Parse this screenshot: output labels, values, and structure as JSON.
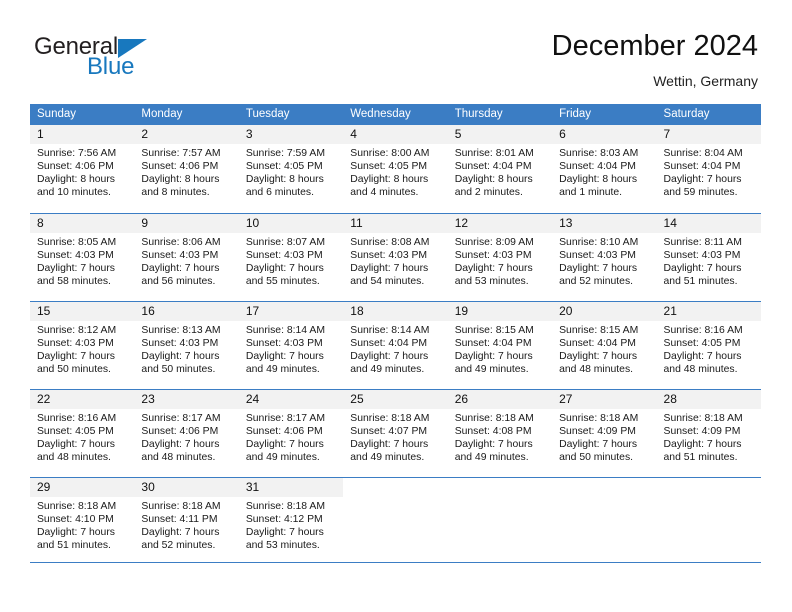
{
  "brand": {
    "name_top": "General",
    "name_bottom": "Blue",
    "accent_color": "#1878be"
  },
  "header": {
    "title": "December 2024",
    "location": "Wettin, Germany"
  },
  "theme": {
    "header_blue": "#3b7dc4",
    "day_band_gray": "#f2f2f2"
  },
  "weekdays": [
    "Sunday",
    "Monday",
    "Tuesday",
    "Wednesday",
    "Thursday",
    "Friday",
    "Saturday"
  ],
  "weeks": [
    [
      {
        "day": "1",
        "sunrise": "Sunrise: 7:56 AM",
        "sunset": "Sunset: 4:06 PM",
        "daylight_1": "Daylight: 8 hours",
        "daylight_2": "and 10 minutes."
      },
      {
        "day": "2",
        "sunrise": "Sunrise: 7:57 AM",
        "sunset": "Sunset: 4:06 PM",
        "daylight_1": "Daylight: 8 hours",
        "daylight_2": "and 8 minutes."
      },
      {
        "day": "3",
        "sunrise": "Sunrise: 7:59 AM",
        "sunset": "Sunset: 4:05 PM",
        "daylight_1": "Daylight: 8 hours",
        "daylight_2": "and 6 minutes."
      },
      {
        "day": "4",
        "sunrise": "Sunrise: 8:00 AM",
        "sunset": "Sunset: 4:05 PM",
        "daylight_1": "Daylight: 8 hours",
        "daylight_2": "and 4 minutes."
      },
      {
        "day": "5",
        "sunrise": "Sunrise: 8:01 AM",
        "sunset": "Sunset: 4:04 PM",
        "daylight_1": "Daylight: 8 hours",
        "daylight_2": "and 2 minutes."
      },
      {
        "day": "6",
        "sunrise": "Sunrise: 8:03 AM",
        "sunset": "Sunset: 4:04 PM",
        "daylight_1": "Daylight: 8 hours",
        "daylight_2": "and 1 minute."
      },
      {
        "day": "7",
        "sunrise": "Sunrise: 8:04 AM",
        "sunset": "Sunset: 4:04 PM",
        "daylight_1": "Daylight: 7 hours",
        "daylight_2": "and 59 minutes."
      }
    ],
    [
      {
        "day": "8",
        "sunrise": "Sunrise: 8:05 AM",
        "sunset": "Sunset: 4:03 PM",
        "daylight_1": "Daylight: 7 hours",
        "daylight_2": "and 58 minutes."
      },
      {
        "day": "9",
        "sunrise": "Sunrise: 8:06 AM",
        "sunset": "Sunset: 4:03 PM",
        "daylight_1": "Daylight: 7 hours",
        "daylight_2": "and 56 minutes."
      },
      {
        "day": "10",
        "sunrise": "Sunrise: 8:07 AM",
        "sunset": "Sunset: 4:03 PM",
        "daylight_1": "Daylight: 7 hours",
        "daylight_2": "and 55 minutes."
      },
      {
        "day": "11",
        "sunrise": "Sunrise: 8:08 AM",
        "sunset": "Sunset: 4:03 PM",
        "daylight_1": "Daylight: 7 hours",
        "daylight_2": "and 54 minutes."
      },
      {
        "day": "12",
        "sunrise": "Sunrise: 8:09 AM",
        "sunset": "Sunset: 4:03 PM",
        "daylight_1": "Daylight: 7 hours",
        "daylight_2": "and 53 minutes."
      },
      {
        "day": "13",
        "sunrise": "Sunrise: 8:10 AM",
        "sunset": "Sunset: 4:03 PM",
        "daylight_1": "Daylight: 7 hours",
        "daylight_2": "and 52 minutes."
      },
      {
        "day": "14",
        "sunrise": "Sunrise: 8:11 AM",
        "sunset": "Sunset: 4:03 PM",
        "daylight_1": "Daylight: 7 hours",
        "daylight_2": "and 51 minutes."
      }
    ],
    [
      {
        "day": "15",
        "sunrise": "Sunrise: 8:12 AM",
        "sunset": "Sunset: 4:03 PM",
        "daylight_1": "Daylight: 7 hours",
        "daylight_2": "and 50 minutes."
      },
      {
        "day": "16",
        "sunrise": "Sunrise: 8:13 AM",
        "sunset": "Sunset: 4:03 PM",
        "daylight_1": "Daylight: 7 hours",
        "daylight_2": "and 50 minutes."
      },
      {
        "day": "17",
        "sunrise": "Sunrise: 8:14 AM",
        "sunset": "Sunset: 4:03 PM",
        "daylight_1": "Daylight: 7 hours",
        "daylight_2": "and 49 minutes."
      },
      {
        "day": "18",
        "sunrise": "Sunrise: 8:14 AM",
        "sunset": "Sunset: 4:04 PM",
        "daylight_1": "Daylight: 7 hours",
        "daylight_2": "and 49 minutes."
      },
      {
        "day": "19",
        "sunrise": "Sunrise: 8:15 AM",
        "sunset": "Sunset: 4:04 PM",
        "daylight_1": "Daylight: 7 hours",
        "daylight_2": "and 49 minutes."
      },
      {
        "day": "20",
        "sunrise": "Sunrise: 8:15 AM",
        "sunset": "Sunset: 4:04 PM",
        "daylight_1": "Daylight: 7 hours",
        "daylight_2": "and 48 minutes."
      },
      {
        "day": "21",
        "sunrise": "Sunrise: 8:16 AM",
        "sunset": "Sunset: 4:05 PM",
        "daylight_1": "Daylight: 7 hours",
        "daylight_2": "and 48 minutes."
      }
    ],
    [
      {
        "day": "22",
        "sunrise": "Sunrise: 8:16 AM",
        "sunset": "Sunset: 4:05 PM",
        "daylight_1": "Daylight: 7 hours",
        "daylight_2": "and 48 minutes."
      },
      {
        "day": "23",
        "sunrise": "Sunrise: 8:17 AM",
        "sunset": "Sunset: 4:06 PM",
        "daylight_1": "Daylight: 7 hours",
        "daylight_2": "and 48 minutes."
      },
      {
        "day": "24",
        "sunrise": "Sunrise: 8:17 AM",
        "sunset": "Sunset: 4:06 PM",
        "daylight_1": "Daylight: 7 hours",
        "daylight_2": "and 49 minutes."
      },
      {
        "day": "25",
        "sunrise": "Sunrise: 8:18 AM",
        "sunset": "Sunset: 4:07 PM",
        "daylight_1": "Daylight: 7 hours",
        "daylight_2": "and 49 minutes."
      },
      {
        "day": "26",
        "sunrise": "Sunrise: 8:18 AM",
        "sunset": "Sunset: 4:08 PM",
        "daylight_1": "Daylight: 7 hours",
        "daylight_2": "and 49 minutes."
      },
      {
        "day": "27",
        "sunrise": "Sunrise: 8:18 AM",
        "sunset": "Sunset: 4:09 PM",
        "daylight_1": "Daylight: 7 hours",
        "daylight_2": "and 50 minutes."
      },
      {
        "day": "28",
        "sunrise": "Sunrise: 8:18 AM",
        "sunset": "Sunset: 4:09 PM",
        "daylight_1": "Daylight: 7 hours",
        "daylight_2": "and 51 minutes."
      }
    ],
    [
      {
        "day": "29",
        "sunrise": "Sunrise: 8:18 AM",
        "sunset": "Sunset: 4:10 PM",
        "daylight_1": "Daylight: 7 hours",
        "daylight_2": "and 51 minutes."
      },
      {
        "day": "30",
        "sunrise": "Sunrise: 8:18 AM",
        "sunset": "Sunset: 4:11 PM",
        "daylight_1": "Daylight: 7 hours",
        "daylight_2": "and 52 minutes."
      },
      {
        "day": "31",
        "sunrise": "Sunrise: 8:18 AM",
        "sunset": "Sunset: 4:12 PM",
        "daylight_1": "Daylight: 7 hours",
        "daylight_2": "and 53 minutes."
      },
      {
        "day": "",
        "sunrise": "",
        "sunset": "",
        "daylight_1": "",
        "daylight_2": ""
      },
      {
        "day": "",
        "sunrise": "",
        "sunset": "",
        "daylight_1": "",
        "daylight_2": ""
      },
      {
        "day": "",
        "sunrise": "",
        "sunset": "",
        "daylight_1": "",
        "daylight_2": ""
      },
      {
        "day": "",
        "sunrise": "",
        "sunset": "",
        "daylight_1": "",
        "daylight_2": ""
      }
    ]
  ]
}
